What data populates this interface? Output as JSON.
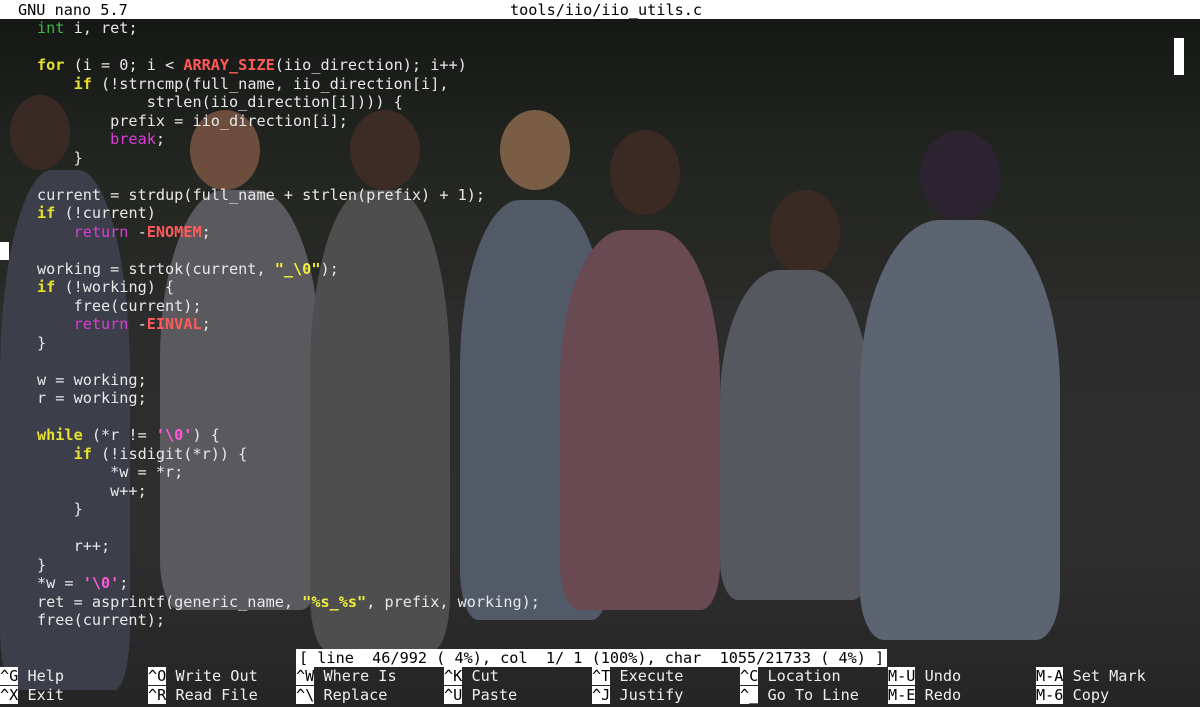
{
  "titlebar": {
    "app": "GNU nano 5.7",
    "file": "tools/iio/iio_utils.c"
  },
  "code_lines": [
    "\t<span class=\"ty\">int</span> i, ret;",
    "",
    "\t<span class=\"kw\">for</span> (i = 0; i &lt; <span class=\"mac\">ARRAY_SIZE</span>(iio_direction); i++)",
    "\t\t<span class=\"kw\">if</span> (!strncmp(full_name, iio_direction[i],",
    "\t\t\t\tstrlen(iio_direction[i]))) {",
    "\t\t\tprefix = iio_direction[i];",
    "\t\t\t<span class=\"br\">break</span>;",
    "\t\t}",
    "",
    "\tcurrent = strdup(full_name + strlen(prefix) + 1);",
    "\t<span class=\"kw\">if</span> (!current)",
    "\t\t<span class=\"br\">return</span> -<span class=\"mac\">ENOMEM</span>;",
    "",
    "\tworking = strtok(current, <span class=\"str\">\"_\\0\"</span>);",
    "\t<span class=\"kw\">if</span> (!working) {",
    "\t\tfree(current);",
    "\t\t<span class=\"br\">return</span> -<span class=\"mac\">EINVAL</span>;",
    "\t}",
    "",
    "\tw = working;",
    "\tr = working;",
    "",
    "\t<span class=\"kw\">while</span> (*r != <span class=\"chr\">'\\0'</span>) {",
    "\t\t<span class=\"kw\">if</span> (!isdigit(*r)) {",
    "\t\t\t*w = *r;",
    "\t\t\tw++;",
    "\t\t}",
    "",
    "\t\tr++;",
    "\t}",
    "\t*w = <span class=\"chr\">'\\0'</span>;",
    "\tret = asprintf(generic_name, <span class=\"str\">\"%s_%s\"</span>, prefix, working);",
    "\tfree(current);"
  ],
  "status": "[ line  46/992 ( 4%), col  1/ 1 (100%), char  1055/21733 ( 4%) ]",
  "shortcuts": [
    {
      "key": "^G",
      "label": "Help"
    },
    {
      "key": "^X",
      "label": "Exit"
    },
    {
      "key": "^O",
      "label": "Write Out"
    },
    {
      "key": "^R",
      "label": "Read File"
    },
    {
      "key": "^W",
      "label": "Where Is"
    },
    {
      "key": "^\\",
      "label": "Replace"
    },
    {
      "key": "^K",
      "label": "Cut"
    },
    {
      "key": "^U",
      "label": "Paste"
    },
    {
      "key": "^T",
      "label": "Execute"
    },
    {
      "key": "^J",
      "label": "Justify"
    },
    {
      "key": "^C",
      "label": "Location"
    },
    {
      "key": "^_",
      "label": "Go To Line"
    },
    {
      "key": "M-U",
      "label": "Undo"
    },
    {
      "key": "M-E",
      "label": "Redo"
    },
    {
      "key": "M-A",
      "label": "Set Mark"
    },
    {
      "key": "M-6",
      "label": "Copy"
    }
  ]
}
